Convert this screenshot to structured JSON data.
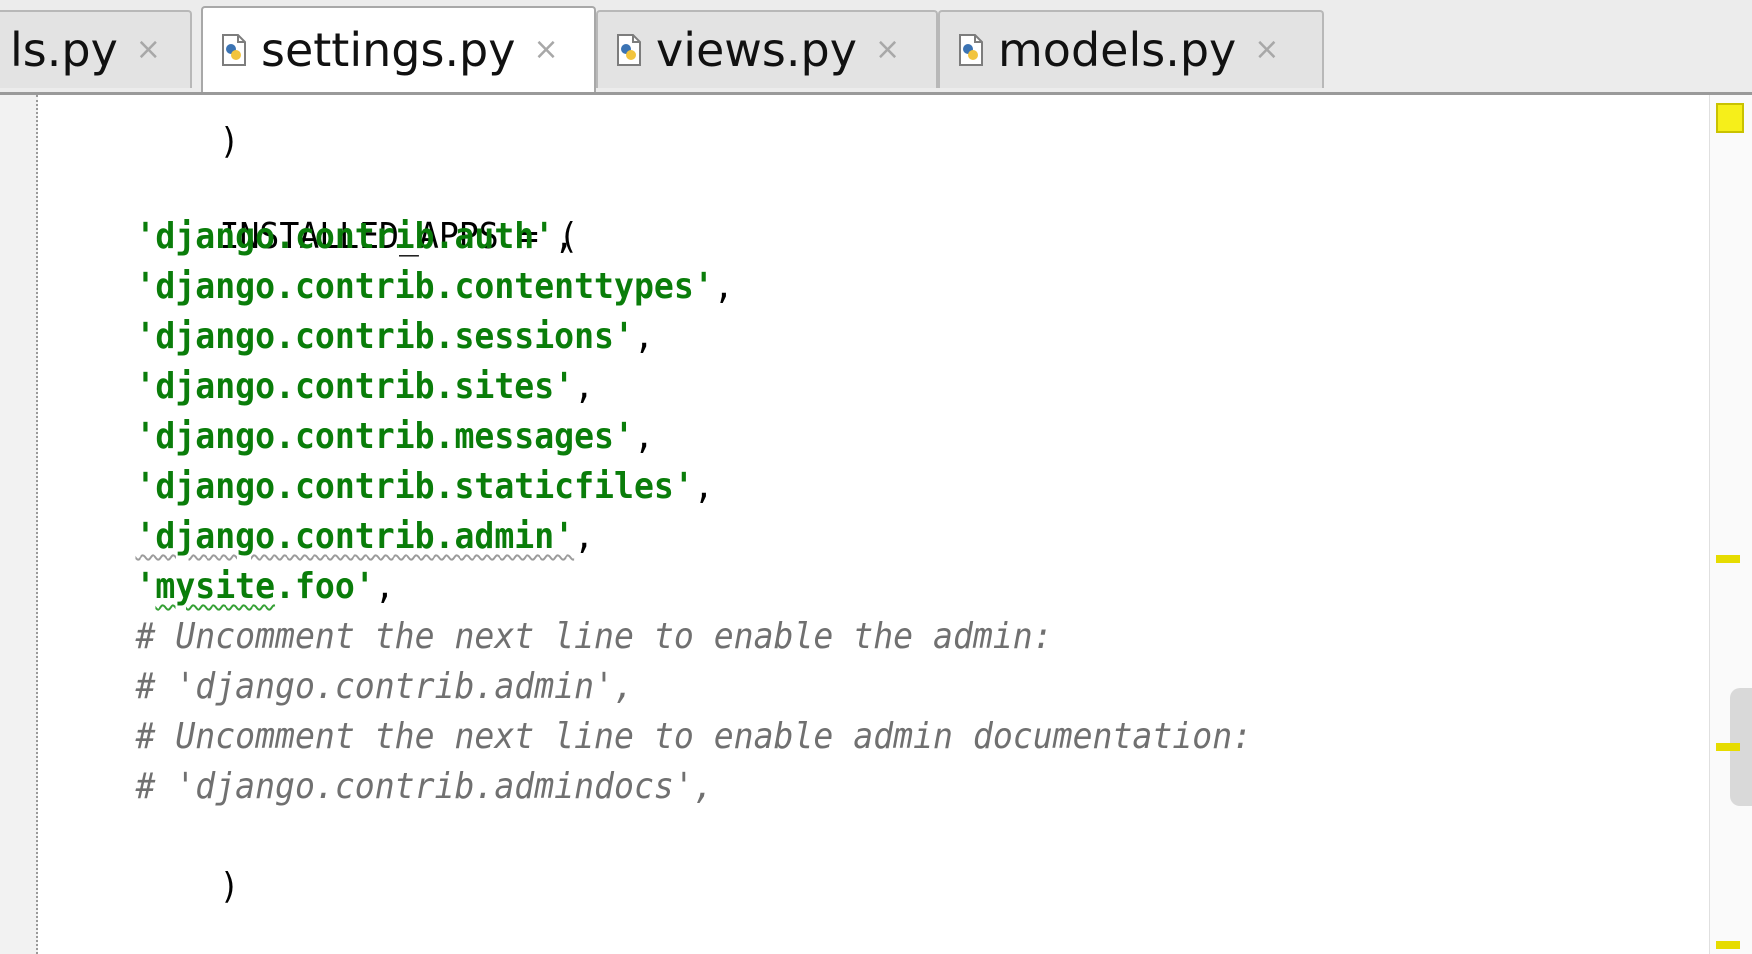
{
  "tabs": [
    {
      "label": "ls.py",
      "close": "×",
      "active": false
    },
    {
      "label": "settings.py",
      "close": "×",
      "active": true
    },
    {
      "label": "views.py",
      "close": "×",
      "active": false
    },
    {
      "label": "models.py",
      "close": "×",
      "active": false
    }
  ],
  "code": {
    "lines": {
      "l0": ")",
      "l2": "INSTALLED_APPS = (",
      "l3s": "'django.contrib.auth'",
      "l3p": ",",
      "l4s": "'django.contrib.contenttypes'",
      "l4p": ",",
      "l5s": "'django.contrib.sessions'",
      "l5p": ",",
      "l6s": "'django.contrib.sites'",
      "l6p": ",",
      "l7s": "'django.contrib.messages'",
      "l7p": ",",
      "l8s": "'django.contrib.staticfiles'",
      "l8p": ",",
      "l9s": "'django.contrib.admin'",
      "l9p": ",",
      "l10q": "'",
      "l10a": "mysite",
      "l10b": ".foo'",
      "l10p": ",",
      "l11": "# Uncomment the next line to enable the admin:",
      "l12": "# 'django.contrib.admin',",
      "l13": "# Uncomment the next line to enable admin documentation:",
      "l14": "# 'django.contrib.admindocs',",
      "l15": ")"
    }
  },
  "colors": {
    "string": "#0a7d0a",
    "comment": "#707070",
    "plain": "#000000",
    "marker": "#f6ef1a"
  },
  "icons": {
    "tab_file": "python-file-icon",
    "tab_close": "close-icon"
  }
}
